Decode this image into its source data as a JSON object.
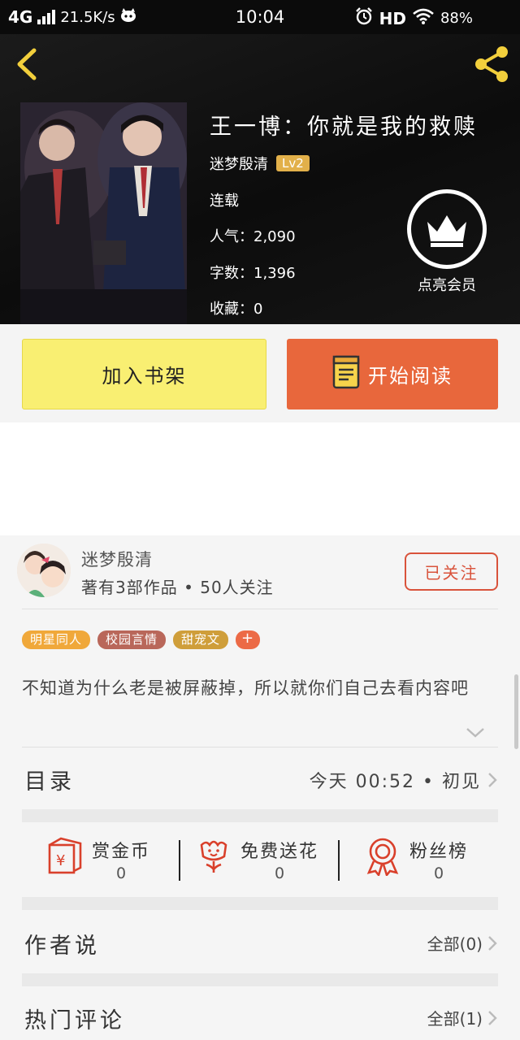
{
  "status_bar": {
    "network": "4G",
    "speed": "21.5K/s",
    "time": "10:04",
    "hd": "HD",
    "battery": "88%"
  },
  "book": {
    "title": "王一博：你就是我的救赎",
    "author": "迷梦殷清",
    "level": "Lv2",
    "status": "连载",
    "popularity_label": "人气：",
    "popularity": "2,090",
    "words_label": "字数：",
    "words": "1,396",
    "favorites_label": "收藏：",
    "favorites": "0",
    "vip_label": "点亮会员"
  },
  "actions": {
    "add_shelf": "加入书架",
    "start_read": "开始阅读"
  },
  "author_card": {
    "name": "迷梦殷清",
    "stats": "著有3部作品 • 50人关注",
    "follow": "已关注"
  },
  "tags": [
    {
      "label": "明星同人",
      "color": "#f0a83a"
    },
    {
      "label": "校园言情",
      "color": "#b9675a"
    },
    {
      "label": "甜宠文",
      "color": "#cf9e3a"
    },
    {
      "label": "+",
      "color": "#ec6a46"
    }
  ],
  "description": "不知道为什么老是被屏蔽掉，所以就你们自己去看内容吧",
  "catalog": {
    "title": "目录",
    "update": "今天 00:52 • 初见"
  },
  "stats": [
    {
      "label": "赏金币",
      "value": "0",
      "icon": "red-envelope-icon"
    },
    {
      "label": "免费送花",
      "value": "0",
      "icon": "flower-icon"
    },
    {
      "label": "粉丝榜",
      "value": "0",
      "icon": "medal-icon"
    }
  ],
  "author_says": {
    "title": "作者说",
    "link": "全部(0)"
  },
  "hot_comments": {
    "title": "热门评论",
    "link": "全部(1)"
  },
  "colors": {
    "accent": "#e8673c",
    "shelf_button": "#f9ef72",
    "follow": "#d9533b",
    "level_badge": "#e2b04a"
  }
}
